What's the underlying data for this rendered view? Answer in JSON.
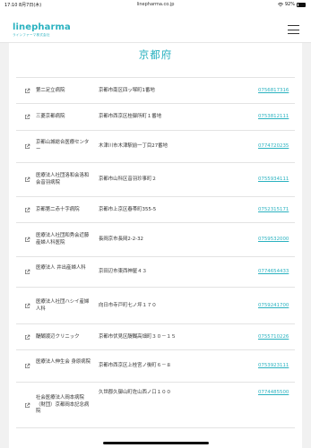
{
  "status_bar": {
    "time": "17:10  8月7日(木)",
    "url": "linepharma.co.jp",
    "battery": "92%"
  },
  "header": {
    "logo_text": "linepharma",
    "logo_sub": "ラインファーマ株式会社"
  },
  "page": {
    "title": "京都府"
  },
  "hospitals": [
    {
      "name": "第二足立病院",
      "address": "京都市南区四ッ塚町1番地",
      "tel": "0756817316"
    },
    {
      "name": "三菱京都病院",
      "address": "京都市西京区桂御所町１番地",
      "tel": "0753812111"
    },
    {
      "name": "京都山城総合医療センター",
      "address": "木津川市木津駅前一丁目27番地",
      "tel": "0774720235"
    },
    {
      "name": "医療法人社団洛和会洛和会音羽病院",
      "address": "京都市山科区音羽珍事町２",
      "tel": "0755934111"
    },
    {
      "name": "京都第二赤十字病院",
      "address": "京都市上京区春帯町355-5",
      "tel": "0752315171"
    },
    {
      "name": "医療法人社団和秀会近藤産婦人科医院",
      "address": "長岡京市長岡2-2-32",
      "tel": "0759532000"
    },
    {
      "name": "医療法人 井出産婦人科",
      "address": "京田辺市東西神屋４３",
      "tel": "0774654433"
    },
    {
      "name": "医療法人社団ハシイ産婦人科",
      "address": "向日市寺戸町七ノ坪１７０",
      "tel": "0759241700"
    },
    {
      "name": "醍醐渡辺クリニック",
      "address": "京都市伏見区醍醐高畑町３０－１５",
      "tel": "0755710226"
    },
    {
      "name": "医療法人伸生会 身原病院",
      "address": "京都市西京区上桂宮ノ後町６－８",
      "tel": "0753923111"
    },
    {
      "name": "社会医療法人岡本病院（財団）京都岡本記念病院",
      "address": "久世郡久御山町佐山西ノ口１００",
      "tel": "0774485500"
    }
  ]
}
